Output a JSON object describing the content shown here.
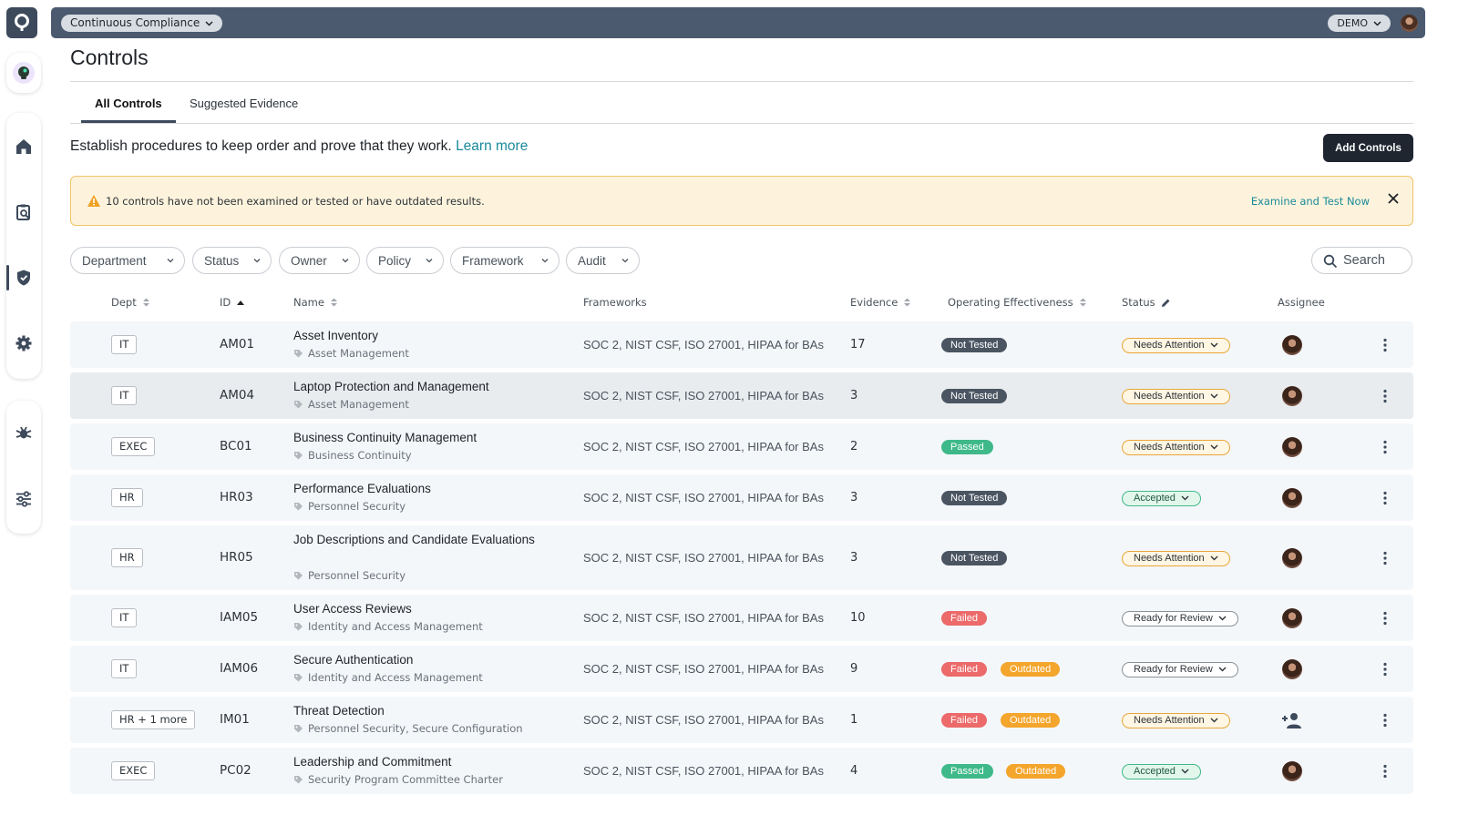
{
  "topbar": {
    "app_switcher": "Continuous Compliance",
    "env_switcher": "DEMO"
  },
  "page": {
    "title": "Controls",
    "tabs": [
      "All Controls",
      "Suggested Evidence"
    ],
    "intro": "Establish procedures to keep order and prove that they work.",
    "learn_more": "Learn more",
    "add_button": "Add Controls"
  },
  "alert": {
    "message": "10 controls have not been examined or tested or have outdated results.",
    "action": "Examine and Test Now"
  },
  "filters": [
    "Department",
    "Status",
    "Owner",
    "Policy",
    "Framework",
    "Audit"
  ],
  "search": {
    "label": "Search"
  },
  "table": {
    "headers": {
      "dept": "Dept",
      "id": "ID",
      "name": "Name",
      "frameworks": "Frameworks",
      "evidence": "Evidence",
      "operating": "Operating Effectiveness",
      "status": "Status",
      "assignee": "Assignee"
    },
    "rows": [
      {
        "dept": "IT",
        "id": "AM01",
        "name": "Asset Inventory",
        "category": "Asset Management",
        "frameworks": "SOC 2, NIST CSF, ISO 27001, HIPAA for BAs",
        "evidence": "17",
        "effectiveness": [
          {
            "label": "Not Tested",
            "tone": "gray"
          }
        ],
        "status": "Needs Attention",
        "status_tone": "attn",
        "assigned": true
      },
      {
        "dept": "IT",
        "id": "AM04",
        "name": "Laptop Protection and Management",
        "category": "Asset Management",
        "frameworks": "SOC 2, NIST CSF, ISO 27001, HIPAA for BAs",
        "evidence": "3",
        "effectiveness": [
          {
            "label": "Not Tested",
            "tone": "gray"
          }
        ],
        "status": "Needs Attention",
        "status_tone": "attn",
        "assigned": true
      },
      {
        "dept": "EXEC",
        "id": "BC01",
        "name": "Business Continuity Management",
        "category": "Business Continuity",
        "frameworks": "SOC 2, NIST CSF, ISO 27001, HIPAA for BAs",
        "evidence": "2",
        "effectiveness": [
          {
            "label": "Passed",
            "tone": "green"
          }
        ],
        "status": "Needs Attention",
        "status_tone": "attn",
        "assigned": true
      },
      {
        "dept": "HR",
        "id": "HR03",
        "name": "Performance Evaluations",
        "category": "Personnel Security",
        "frameworks": "SOC 2, NIST CSF, ISO 27001, HIPAA for BAs",
        "evidence": "3",
        "effectiveness": [
          {
            "label": "Not Tested",
            "tone": "gray"
          }
        ],
        "status": "Accepted",
        "status_tone": "acc",
        "assigned": true
      },
      {
        "dept": "HR",
        "id": "HR05",
        "name": "Job Descriptions and Candidate Evaluations",
        "category": "Personnel Security",
        "frameworks": "SOC 2, NIST CSF, ISO 27001, HIPAA for BAs",
        "evidence": "3",
        "effectiveness": [
          {
            "label": "Not Tested",
            "tone": "gray"
          }
        ],
        "status": "Needs Attention",
        "status_tone": "attn",
        "assigned": true
      },
      {
        "dept": "IT",
        "id": "IAM05",
        "name": "User Access Reviews",
        "category": "Identity and Access Management",
        "frameworks": "SOC 2, NIST CSF, ISO 27001, HIPAA for BAs",
        "evidence": "10",
        "effectiveness": [
          {
            "label": "Failed",
            "tone": "red"
          }
        ],
        "status": "Ready for Review",
        "status_tone": "rev",
        "assigned": true
      },
      {
        "dept": "IT",
        "id": "IAM06",
        "name": "Secure Authentication",
        "category": "Identity and Access Management",
        "frameworks": "SOC 2, NIST CSF, ISO 27001, HIPAA for BAs",
        "evidence": "9",
        "effectiveness": [
          {
            "label": "Failed",
            "tone": "red"
          },
          {
            "label": "Outdated",
            "tone": "orange"
          }
        ],
        "status": "Ready for Review",
        "status_tone": "rev",
        "assigned": true
      },
      {
        "dept": "HR + 1 more",
        "id": "IM01",
        "name": "Threat Detection",
        "category": "Personnel Security, Secure Configuration",
        "frameworks": "SOC 2, NIST CSF, ISO 27001, HIPAA for BAs",
        "evidence": "1",
        "effectiveness": [
          {
            "label": "Failed",
            "tone": "red"
          },
          {
            "label": "Outdated",
            "tone": "orange"
          }
        ],
        "status": "Needs Attention",
        "status_tone": "attn",
        "assigned": false
      },
      {
        "dept": "EXEC",
        "id": "PC02",
        "name": "Leadership and Commitment",
        "category": "Security Program Committee Charter",
        "frameworks": "SOC 2, NIST CSF, ISO 27001, HIPAA for BAs",
        "evidence": "4",
        "effectiveness": [
          {
            "label": "Passed",
            "tone": "green"
          },
          {
            "label": "Outdated",
            "tone": "orange"
          }
        ],
        "status": "Accepted",
        "status_tone": "acc",
        "assigned": true
      }
    ]
  },
  "colors": {
    "topbar": "#4b5a6e",
    "accent_link": "#1a8a9a",
    "primary_button": "#1f2630",
    "alert_bg": "#fdf3dc",
    "not_tested": "#4b5562",
    "passed": "#3fb98a",
    "failed": "#ec6a6a",
    "outdated": "#f4a52b"
  },
  "icons": [
    "logo-icon",
    "agent-icon",
    "home-icon",
    "clipboard-search-icon",
    "shield-icon",
    "gear-icon",
    "bug-icon",
    "sliders-icon",
    "warning-icon",
    "close-icon",
    "search-icon",
    "sort-icon",
    "pencil-icon",
    "tag-icon",
    "add-user-icon",
    "kebab-icon",
    "chevron-down-icon"
  ]
}
